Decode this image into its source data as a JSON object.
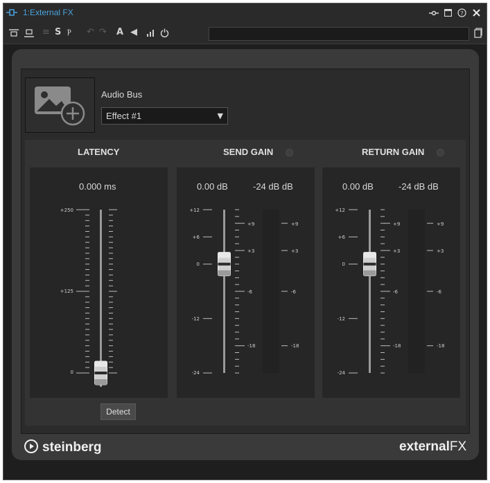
{
  "window": {
    "title": "1:External FX"
  },
  "audio_bus": {
    "label": "Audio Bus",
    "selected": "Effect #1"
  },
  "latency": {
    "header": "LATENCY",
    "readout": "0.000 ms",
    "scale_labels": [
      "+250",
      "+125",
      "0"
    ],
    "value_ms": 0,
    "range": [
      0,
      250
    ],
    "detect_label": "Detect"
  },
  "send_gain": {
    "header": "SEND GAIN",
    "readout": "0.00 dB",
    "peak_readout": "-24 dB dB",
    "fader_labels": [
      "+12",
      "+6",
      "0",
      "-12",
      "-24"
    ],
    "meter_labels": [
      "+9",
      "+3",
      "-6",
      "-18"
    ],
    "value_db": 0
  },
  "return_gain": {
    "header": "RETURN GAIN",
    "readout": "0.00 dB",
    "peak_readout": "-24 dB dB",
    "fader_labels": [
      "+12",
      "+6",
      "0",
      "-12",
      "-24"
    ],
    "meter_labels": [
      "+9",
      "+3",
      "-6",
      "-18"
    ],
    "value_db": 0
  },
  "footer": {
    "vendor": "steinberg",
    "product_a": "external",
    "product_b": "FX"
  },
  "colors": {
    "title_text": "#4aa3df",
    "background": "#1e1e1e",
    "panel": "#3a3a3a"
  },
  "icons": {
    "titlebar": [
      "route-icon",
      "maximize-icon",
      "help-icon",
      "close-icon"
    ],
    "toolbar": [
      "align-top-icon",
      "align-bottom-icon",
      "bypass-icon",
      "mono-icon",
      "undo-icon",
      "redo-icon",
      "automation-icon",
      "input-icon",
      "meter-icon",
      "power-icon",
      "preset-menu-icon"
    ]
  }
}
